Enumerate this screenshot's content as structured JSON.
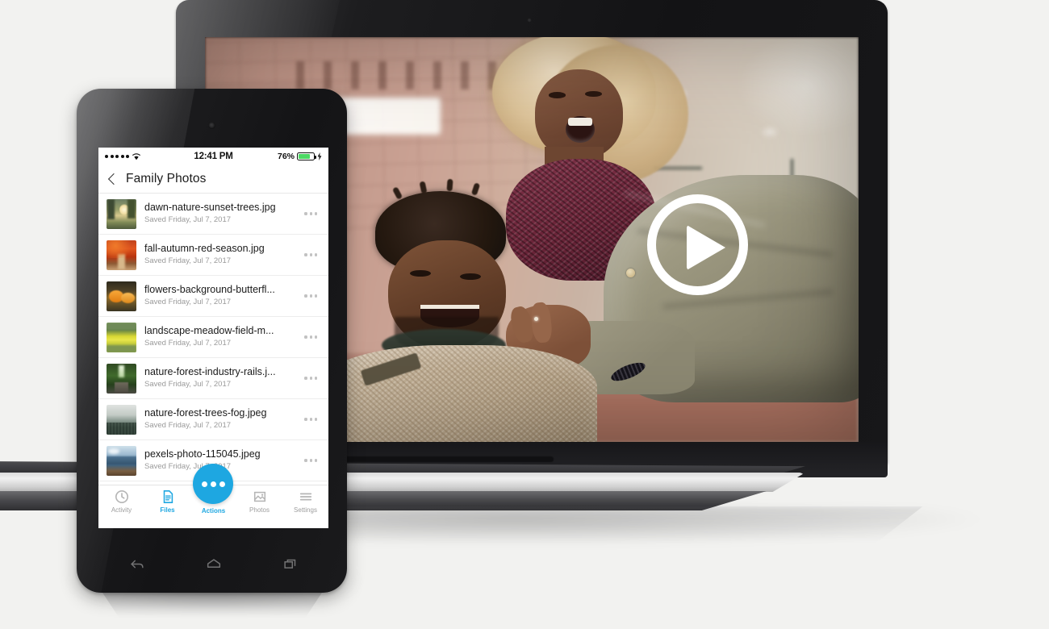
{
  "page": {
    "background_color": "#f2f2f0",
    "accent_color": "#1ea7e1"
  },
  "laptop": {
    "device_name": "laptop",
    "video": {
      "play_button": "play-button",
      "scene_description": "Two people laughing outdoors in front of a brick and stone wall"
    }
  },
  "phone": {
    "device_name": "smartphone",
    "status_bar": {
      "signal": "●●●●●",
      "wifi_icon": "wifi-icon",
      "time": "12:41 PM",
      "battery_percent": "76%",
      "battery_level": 76,
      "battery_color": "#4cd964",
      "charging_icon": "lightning-icon"
    },
    "navbar": {
      "back_label": "back-chevron",
      "title": "Family Photos"
    },
    "files": [
      {
        "name": "dawn-nature-sunset-trees.jpg",
        "saved": "Saved Friday, Jul 7, 2017",
        "thumb": "sunset-trees"
      },
      {
        "name": "fall-autumn-red-season.jpg",
        "saved": "Saved Friday, Jul 7, 2017",
        "thumb": "red-autumn"
      },
      {
        "name": "flowers-background-butterfl...",
        "saved": "Saved Friday, Jul 7, 2017",
        "thumb": "orange-flowers"
      },
      {
        "name": "landscape-meadow-field-m...",
        "saved": "Saved Friday, Jul 7, 2017",
        "thumb": "yellow-meadow"
      },
      {
        "name": "nature-forest-industry-rails.j...",
        "saved": "Saved Friday, Jul 7, 2017",
        "thumb": "green-rails"
      },
      {
        "name": "nature-forest-trees-fog.jpeg",
        "saved": "Saved Friday, Jul 7, 2017",
        "thumb": "foggy-forest"
      },
      {
        "name": "pexels-photo-115045.jpeg",
        "saved": "Saved Friday, Jul 7, 2017",
        "thumb": "blue-mountains"
      }
    ],
    "row_menu_icon": "kebab-menu-icon",
    "tabbar": [
      {
        "label": "Activity",
        "icon": "clock-icon",
        "active": false
      },
      {
        "label": "Files",
        "icon": "document-icon",
        "active": true
      },
      {
        "label": "Actions",
        "icon": "ellipsis-icon",
        "active": true
      },
      {
        "label": "Photos",
        "icon": "image-icon",
        "active": false
      },
      {
        "label": "Settings",
        "icon": "hamburger-icon",
        "active": false
      }
    ],
    "android_nav": [
      {
        "name": "back-button"
      },
      {
        "name": "home-button"
      },
      {
        "name": "recents-button"
      }
    ]
  }
}
